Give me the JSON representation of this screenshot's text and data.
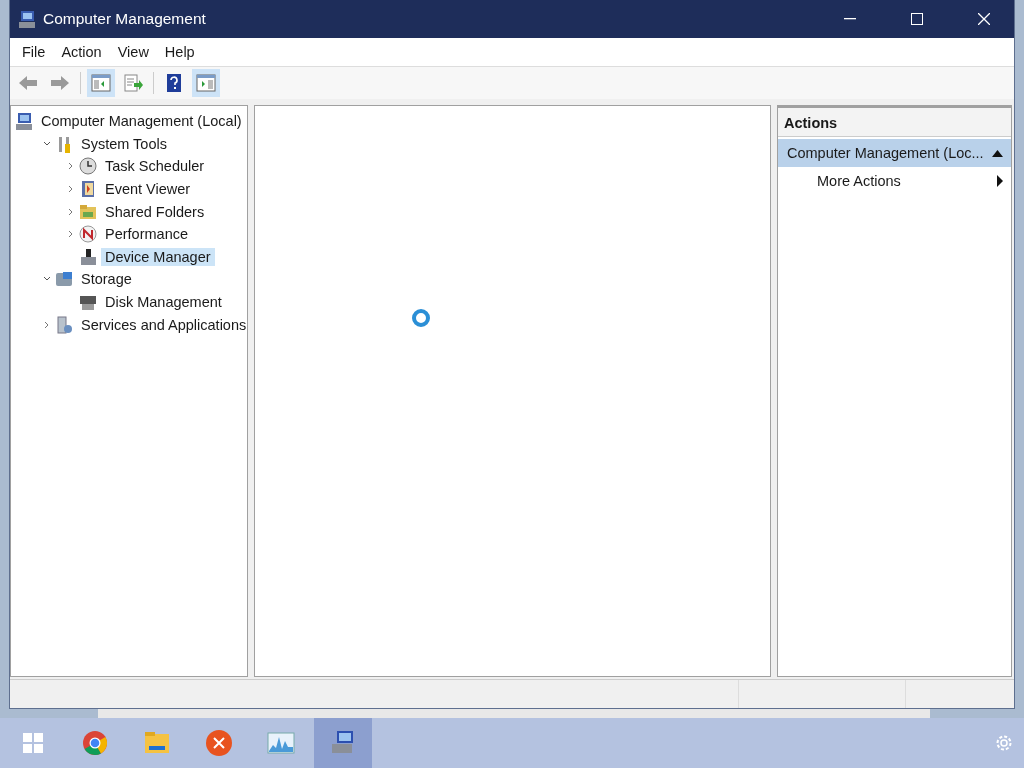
{
  "window": {
    "title": "Computer Management"
  },
  "menu": [
    "File",
    "Action",
    "View",
    "Help"
  ],
  "toolbar": [
    {
      "kind": "back",
      "disabled": true,
      "pressed": false
    },
    {
      "kind": "forward",
      "disabled": true,
      "pressed": false
    },
    {
      "kind": "tree",
      "disabled": false,
      "pressed": true
    },
    {
      "kind": "export",
      "disabled": false,
      "pressed": false
    },
    {
      "kind": "help",
      "disabled": false,
      "pressed": false
    },
    {
      "kind": "actions",
      "disabled": false,
      "pressed": true
    }
  ],
  "tree": [
    {
      "label": "Computer Management (Local)",
      "selected": false,
      "children": [
        {
          "label": "System Tools",
          "expanded": true,
          "selected": false,
          "children": [
            {
              "label": "Task Scheduler",
              "expanded": false,
              "selected": false
            },
            {
              "label": "Event Viewer",
              "expanded": false,
              "selected": false
            },
            {
              "label": "Shared Folders",
              "expanded": false,
              "selected": false
            },
            {
              "label": "Performance",
              "expanded": false,
              "selected": false
            },
            {
              "label": "Device Manager",
              "selected": true
            }
          ]
        },
        {
          "label": "Storage",
          "expanded": true,
          "selected": false,
          "children": [
            {
              "label": "Disk Management",
              "selected": false
            }
          ]
        },
        {
          "label": "Services and Applications",
          "expanded": false,
          "selected": false
        }
      ]
    }
  ],
  "content": {
    "loading": true
  },
  "actions": {
    "title": "Actions",
    "sections": [
      {
        "label": "Computer Management (Loc...",
        "expanded": true,
        "items": [
          "More Actions"
        ]
      }
    ]
  },
  "taskbar": [
    {
      "kind": "start",
      "selected": false
    },
    {
      "kind": "browser",
      "selected": false
    },
    {
      "kind": "folder",
      "selected": false
    },
    {
      "kind": "close-app",
      "selected": false
    },
    {
      "kind": "monitor",
      "selected": false
    },
    {
      "kind": "management",
      "selected": true
    }
  ]
}
